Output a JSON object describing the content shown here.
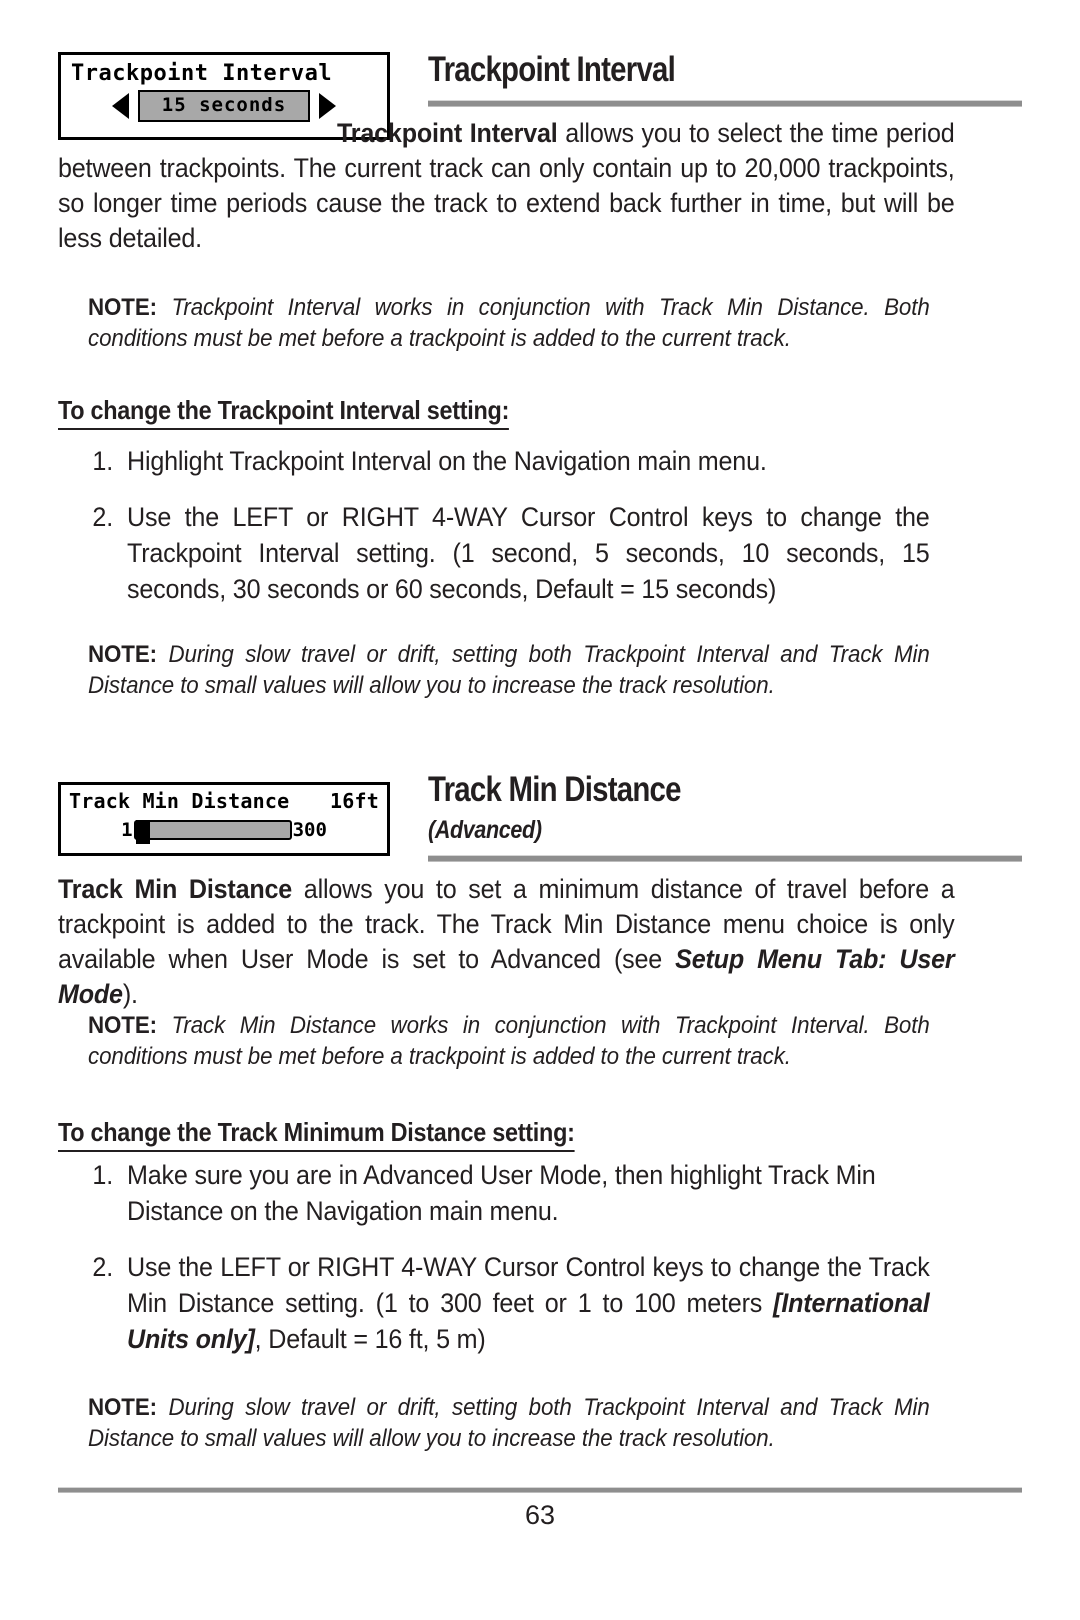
{
  "page": {
    "number": "63"
  },
  "lcd_trackpoint": {
    "title": "Trackpoint Interval",
    "value": "15 seconds",
    "left_arrow": "left-arrow",
    "right_arrow": "right-arrow"
  },
  "lcd_track_min_distance": {
    "title": "Track Min Distance",
    "value": "16ft",
    "slider_min": "1",
    "slider_max": "300",
    "slider_fill_percent": 4
  },
  "section_trackpoint": {
    "heading": "Trackpoint Interval",
    "intro_bold": "Trackpoint Interval",
    "intro_rest": " allows you to select the time period between trackpoints.  The current track can only contain up to 20,000 trackpoints, so longer time periods cause the track to extend back further in time, but will be less detailed.",
    "note_label": "NOTE:",
    "note_text": " Trackpoint Interval works in conjunction with Track Min Distance.  Both conditions must be met before a trackpoint is added to the current track.",
    "sub_heading": "To change the Trackpoint Interval setting:",
    "steps": [
      {
        "num": "1.",
        "text": "Highlight Trackpoint Interval on the Navigation main menu."
      },
      {
        "num": "2.",
        "text": "Use the LEFT or RIGHT 4-WAY Cursor Control keys to change the Trackpoint Interval setting. (1 second, 5 seconds, 10 seconds, 15 seconds, 30 seconds or 60 seconds, Default = 15 seconds)"
      }
    ],
    "note2_label": "NOTE:",
    "note2_text": " During slow travel or drift, setting both Trackpoint Interval and Track Min Distance to small values will allow you to increase the track resolution."
  },
  "section_track_min_distance": {
    "heading": "Track Min Distance",
    "subheading": "(Advanced)",
    "intro_bold": "Track Min Distance",
    "intro_part1": " allows you to set a minimum distance of travel before a trackpoint is added to the track. The Track Min Distance menu choice is only available when User Mode is set to Advanced (see ",
    "intro_emph": "Setup Menu Tab: User Mode",
    "intro_part2": ").",
    "note_label": "NOTE:",
    "note_text": " Track Min Distance works in conjunction with Trackpoint Interval.  Both conditions must be met before a trackpoint is added to the current track.",
    "sub_heading": "To change the Track Minimum Distance setting:",
    "steps": [
      {
        "num": "1.",
        "text": "Make sure you are in Advanced User Mode, then highlight Track Min Distance on the Navigation main menu."
      },
      {
        "num": "2.",
        "text_part1": "Use the LEFT or RIGHT 4-WAY Cursor Control keys to change the Track Min Distance setting. (1 to 300 feet or 1 to 100 meters ",
        "text_emph": "[International Units only]",
        "text_part2": ", Default = 16 ft, 5 m)"
      }
    ],
    "note2_label": "NOTE:",
    "note2_text": " During slow travel or drift, setting both Trackpoint Interval and Track Min Distance to small values will allow you to increase the track resolution."
  },
  "colors": {
    "text": "#231f20",
    "rule": "#8e8e8e",
    "lcd_fill": "#a8a8a8"
  }
}
